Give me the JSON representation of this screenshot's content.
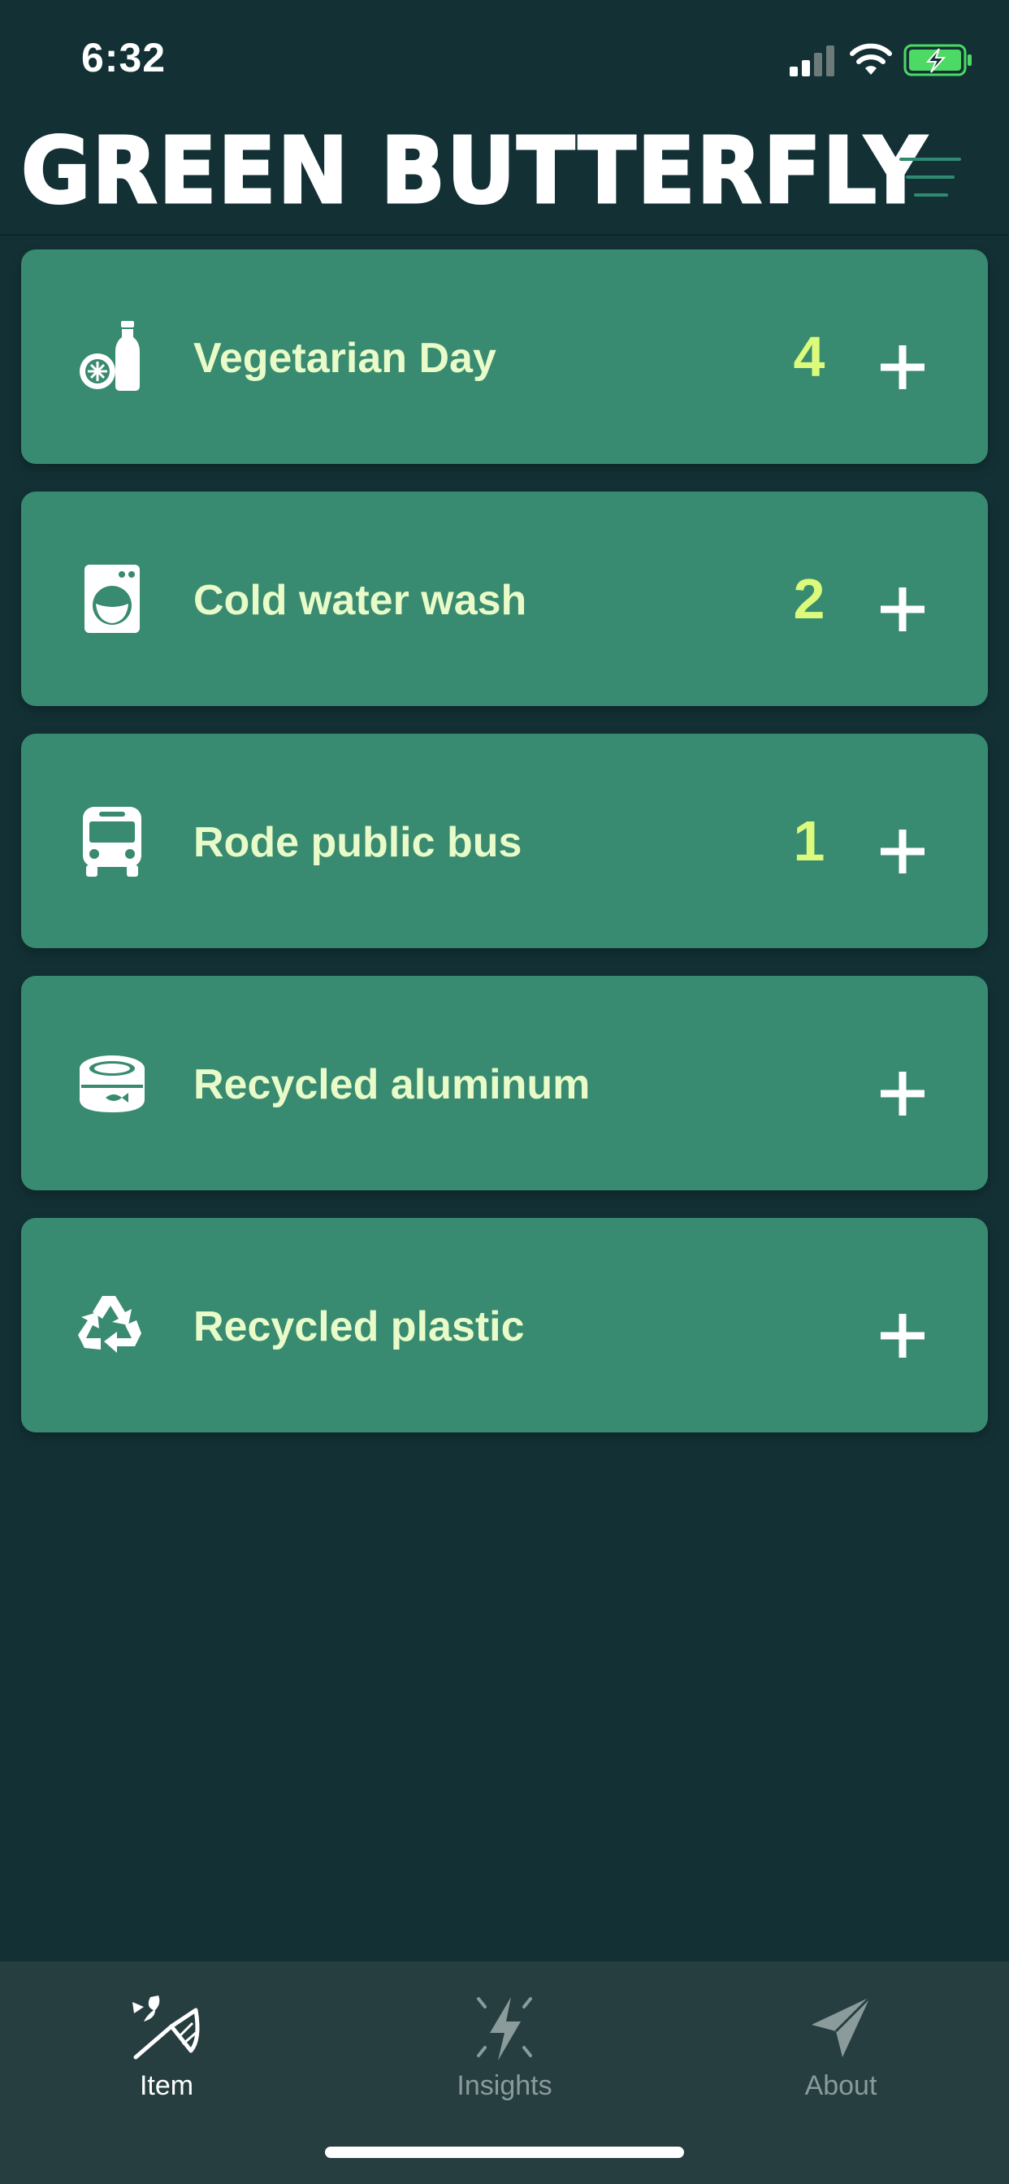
{
  "status_bar": {
    "time": "6:32",
    "icons": [
      "cellular-signal-icon",
      "wifi-icon",
      "battery-charging-icon"
    ]
  },
  "header": {
    "title": "GREEN BUTTERFLY",
    "menu_icon": "hamburger-menu-icon"
  },
  "items": [
    {
      "label": "Vegetarian Day",
      "count": "4",
      "icon": "vegetables-bottle-icon"
    },
    {
      "label": "Cold water wash",
      "count": "2",
      "icon": "washing-machine-icon"
    },
    {
      "label": "Rode public bus",
      "count": "1",
      "icon": "bus-icon"
    },
    {
      "label": "Recycled aluminum",
      "count": "",
      "icon": "tin-can-icon"
    },
    {
      "label": "Recycled plastic",
      "count": "",
      "icon": "recycle-icon"
    }
  ],
  "tab_bar": {
    "tabs": [
      {
        "label": "Item",
        "icon": "butterfly-net-icon",
        "active": true
      },
      {
        "label": "Insights",
        "icon": "lightning-icon",
        "active": false
      },
      {
        "label": "About",
        "icon": "paper-plane-icon",
        "active": false
      }
    ]
  },
  "colors": {
    "background": "#133135",
    "card": "#388a70",
    "label": "#e8fbc8",
    "count": "#dcfb7c",
    "tab_bar": "#263e40",
    "battery": "#4cd964"
  }
}
